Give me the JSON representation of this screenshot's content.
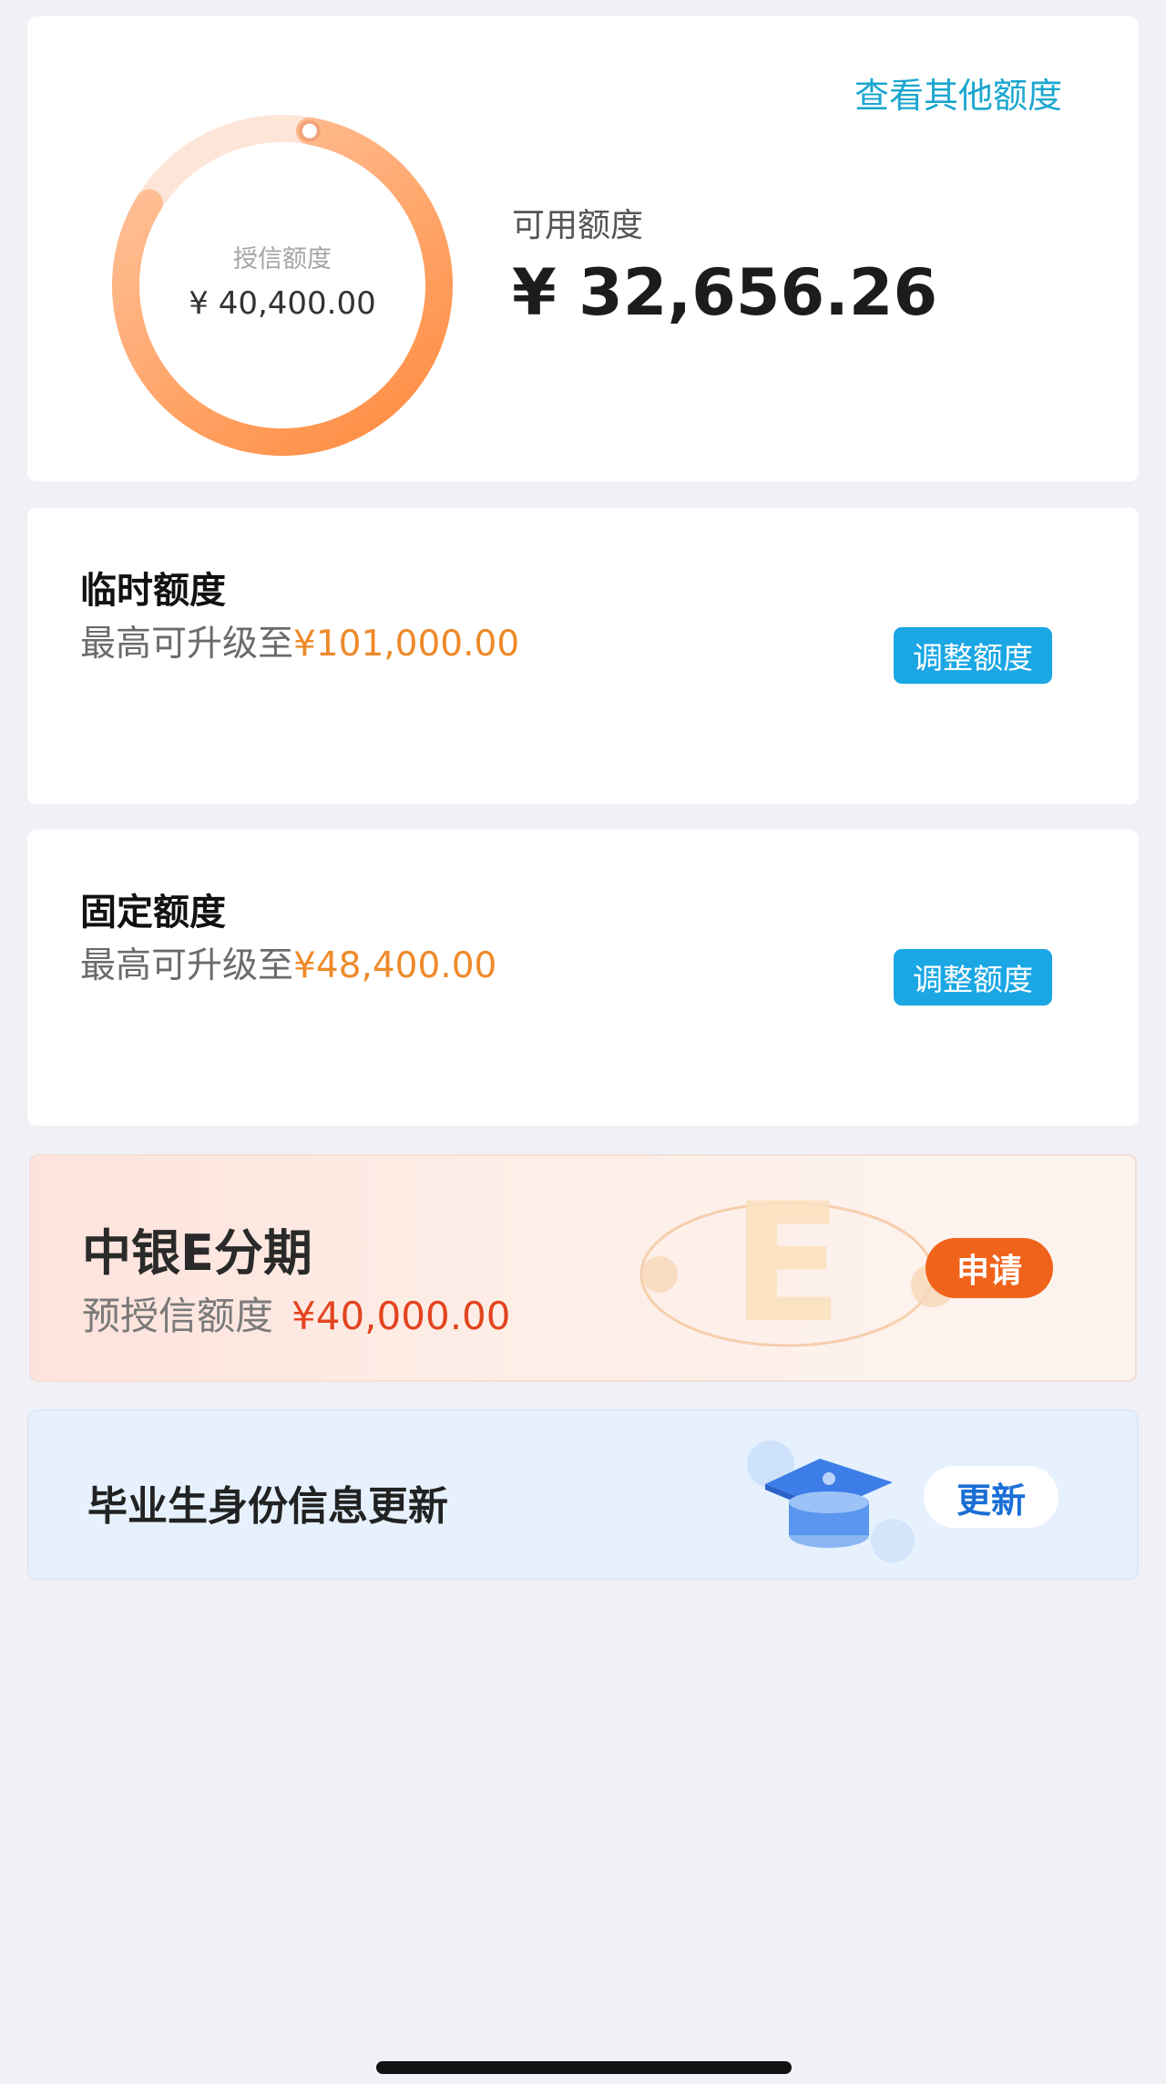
{
  "summary": {
    "other_limits_link": "查看其他额度",
    "credit_limit_label": "授信额度",
    "credit_limit_value": "¥ 40,400.00",
    "available_label": "可用额度",
    "available_value": "¥ 32,656.26",
    "ring_fraction": 0.81,
    "ring_colors": {
      "dark": "#ff8a3d",
      "light": "#ffd6bd"
    }
  },
  "temporary_limit": {
    "title": "临时额度",
    "sub_prefix": "最高可升级至",
    "sub_amount": "¥101,000.00",
    "button": "调整额度"
  },
  "fixed_limit": {
    "title": "固定额度",
    "sub_prefix": "最高可升级至",
    "sub_amount": "¥48,400.00",
    "button": "调整额度"
  },
  "e_installment": {
    "title": "中银E分期",
    "sub_prefix": "预授信额度",
    "sub_amount": "¥40,000.00",
    "button": "申请"
  },
  "graduate": {
    "title": "毕业生身份信息更新",
    "button": "更新"
  }
}
